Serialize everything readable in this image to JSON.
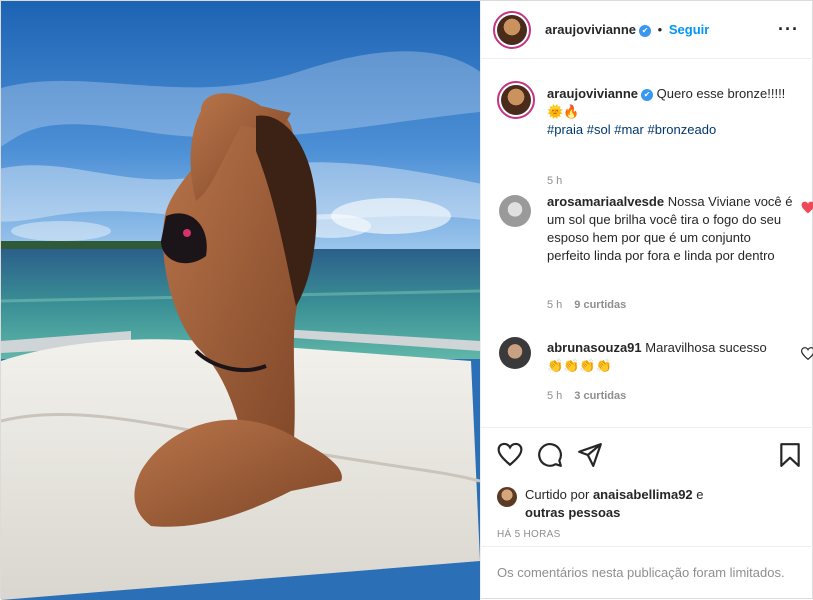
{
  "post": {
    "author": {
      "username": "araujovivianne",
      "verified_badge": "✔",
      "follow_separator": "•",
      "follow_label": "Seguir",
      "more_label": "···"
    },
    "caption": {
      "text": "Quero esse bronze!!!!!",
      "emoji": "🌞🔥",
      "hashtags": [
        "#praia",
        "#sol",
        "#mar",
        "#bronzeado"
      ],
      "time": "5 h"
    },
    "comments": [
      {
        "username": "arosamariaalvesde",
        "text": "Nossa Viviane você é um sol que brilha você tira o fogo do seu esposo hem por que é um conjunto perfeito linda por fora e linda por dentro",
        "time": "5 h",
        "likes": "9 curtidas",
        "liked": true
      },
      {
        "username": "abrunasouza91",
        "text": "Maravilhosa sucesso",
        "emoji": "👏👏👏👏",
        "time": "5 h",
        "likes": "3 curtidas",
        "liked": false
      }
    ],
    "likes": {
      "prefix": "Curtido por",
      "user": "anaisabellima92",
      "connector": "e",
      "others": "outras pessoas"
    },
    "timestamp": "HÁ 5 HORAS",
    "comments_limited": "Os comentários nesta publicação foram limitados.",
    "colors": {
      "link": "#0095f6",
      "hashtag": "#00376b",
      "liked_heart": "#ed4956",
      "muted": "#8e8e8e"
    }
  }
}
